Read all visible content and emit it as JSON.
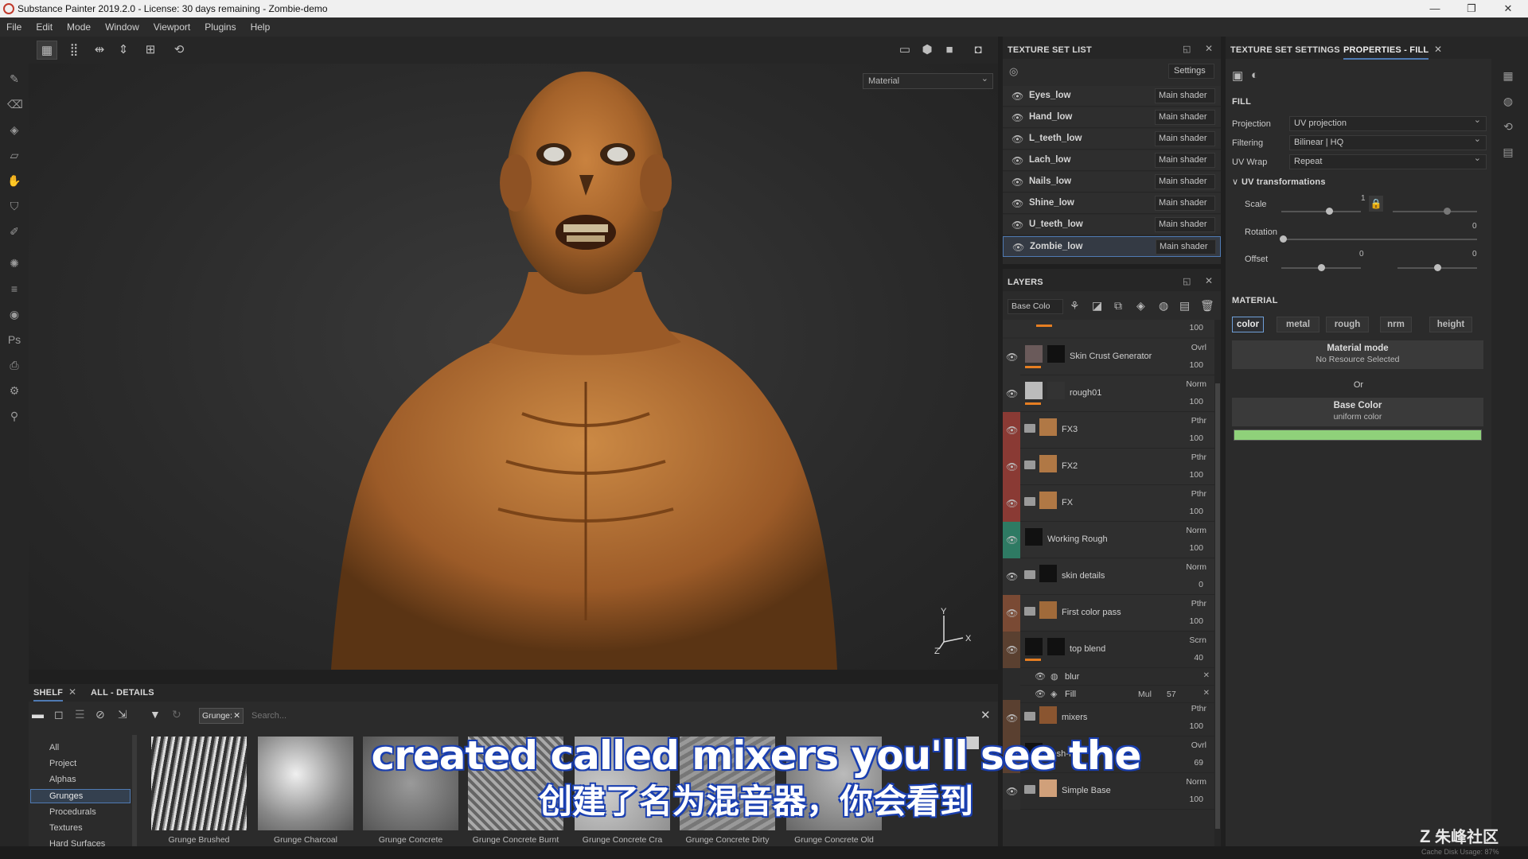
{
  "window": {
    "title": "Substance Painter 2019.2.0 - License: 30 days remaining - Zombie-demo"
  },
  "menu": [
    "File",
    "Edit",
    "Mode",
    "Window",
    "Viewport",
    "Plugins",
    "Help"
  ],
  "viewport": {
    "material_dropdown": "Material",
    "axis": {
      "y": "Y",
      "x": "X",
      "z": "Z"
    }
  },
  "texture_set_list": {
    "title": "TEXTURE SET LIST",
    "settings_label": "Settings",
    "sets": [
      {
        "name": "Eyes_low",
        "shader": "Main shader"
      },
      {
        "name": "Hand_low",
        "shader": "Main shader"
      },
      {
        "name": "L_teeth_low",
        "shader": "Main shader"
      },
      {
        "name": "Lach_low",
        "shader": "Main shader"
      },
      {
        "name": "Nails_low",
        "shader": "Main shader"
      },
      {
        "name": "Shine_low",
        "shader": "Main shader"
      },
      {
        "name": "U_teeth_low",
        "shader": "Main shader"
      },
      {
        "name": "Zombie_low",
        "shader": "Main shader"
      }
    ]
  },
  "layers": {
    "title": "LAYERS",
    "channel_dropdown": "Base Colo",
    "top_opacity": "100",
    "items": [
      {
        "name": "Skin Crust Generator",
        "blend": "Ovrl",
        "opacity": "100",
        "color": "#2f2f2f"
      },
      {
        "name": "rough01",
        "blend": "Norm",
        "opacity": "100",
        "color": "#2f2f2f"
      },
      {
        "name": "FX3",
        "blend": "Pthr",
        "opacity": "100",
        "color": "#8a3a34"
      },
      {
        "name": "FX2",
        "blend": "Pthr",
        "opacity": "100",
        "color": "#8a3a34"
      },
      {
        "name": "FX",
        "blend": "Pthr",
        "opacity": "100",
        "color": "#8a3a34"
      },
      {
        "name": "Working Rough",
        "blend": "Norm",
        "opacity": "100",
        "color": "#2e7a63"
      },
      {
        "name": "skin details",
        "blend": "Norm",
        "opacity": "0",
        "color": "#2f2f2f"
      },
      {
        "name": "First color pass",
        "blend": "Pthr",
        "opacity": "100",
        "color": "#7a4a34"
      },
      {
        "name": "top blend",
        "blend": "Scrn",
        "opacity": "40",
        "color": "#5a4030"
      },
      {
        "name": "mixers",
        "blend": "Pthr",
        "opacity": "100",
        "color": "#5a4030"
      },
      {
        "name": "flesh-fae",
        "blend": "Ovrl",
        "opacity": "69",
        "color": "#5a4030"
      },
      {
        "name": "Simple Base",
        "blend": "Norm",
        "opacity": "100",
        "color": "#2f2f2f"
      }
    ],
    "effects": [
      {
        "name": "blur"
      },
      {
        "name": "Fill",
        "blend": "Mul",
        "opacity": "57"
      }
    ]
  },
  "shelf": {
    "tabs": [
      "SHELF",
      "ALL - DETAILS"
    ],
    "filter_tag": "Grunge:",
    "search_placeholder": "Search...",
    "categories": [
      "All",
      "Project",
      "Alphas",
      "Grunges",
      "Procedurals",
      "Textures",
      "Hard Surfaces"
    ],
    "selected_category": "Grunges",
    "thumbnails": [
      "Grunge Brushed",
      "Grunge Charcoal",
      "Grunge Concrete",
      "Grunge Concrete Burnt",
      "Grunge Concrete Cra",
      "Grunge Concrete Dirty",
      "Grunge Concrete Old"
    ]
  },
  "properties": {
    "tabs": [
      "TEXTURE SET SETTINGS",
      "PROPERTIES - FILL"
    ],
    "fill_header": "FILL",
    "projection_label": "Projection",
    "projection_value": "UV projection",
    "filtering_label": "Filtering",
    "filtering_value": "Bilinear | HQ",
    "uvwrap_label": "UV Wrap",
    "uvwrap_value": "Repeat",
    "uv_transform_header": "UV transformations",
    "scale_label": "Scale",
    "scale_value": "1",
    "rotation_label": "Rotation",
    "rotation_value": "0",
    "offset_label": "Offset",
    "offset_u": "0",
    "offset_v": "0",
    "material_header": "MATERIAL",
    "channels": [
      "color",
      "metal",
      "rough",
      "nrm",
      "height"
    ],
    "material_mode_title": "Material mode",
    "material_mode_sub": "No Resource Selected",
    "or_label": "Or",
    "base_color_title": "Base Color",
    "base_color_sub": "uniform color",
    "base_color_swatch": "#8fd17a"
  },
  "subtitles": {
    "en": "created called mixers you'll see the",
    "zh": "创建了名为混音器，你会看到"
  },
  "watermark": "朱峰社区",
  "status": "Cache Disk Usage: 87%"
}
